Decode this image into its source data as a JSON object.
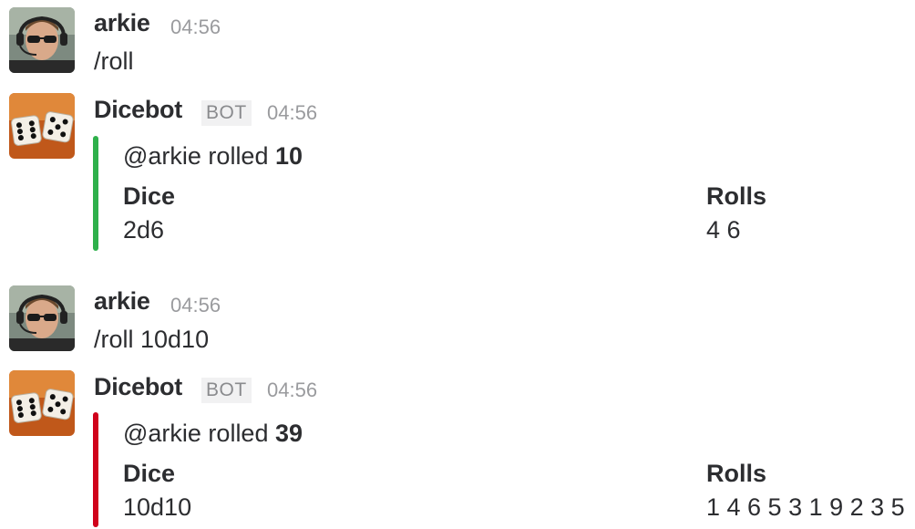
{
  "colors": {
    "good": "#2eb04b",
    "danger": "#d0021b"
  },
  "messages": [
    {
      "sender": "arkie",
      "time": "04:56",
      "text": "/roll",
      "avatar_icon": "user-avatar-icon"
    },
    {
      "sender": "Dicebot",
      "badge": "BOT",
      "time": "04:56",
      "avatar_icon": "dice-avatar-icon",
      "attachment": {
        "color": "#2eb04b",
        "pretext_prefix": "@arkie rolled ",
        "total": "10",
        "fields": [
          {
            "title": "Dice",
            "value": "2d6"
          },
          {
            "title": "Rolls",
            "value": "4 6"
          }
        ]
      }
    },
    {
      "sender": "arkie",
      "time": "04:56",
      "text": "/roll 10d10",
      "avatar_icon": "user-avatar-icon"
    },
    {
      "sender": "Dicebot",
      "badge": "BOT",
      "time": "04:56",
      "avatar_icon": "dice-avatar-icon",
      "attachment": {
        "color": "#d0021b",
        "pretext_prefix": "@arkie rolled ",
        "total": "39",
        "fields": [
          {
            "title": "Dice",
            "value": "10d10"
          },
          {
            "title": "Rolls",
            "value": "1 4 6 5 3 1 9 2 3 5"
          }
        ]
      }
    }
  ]
}
